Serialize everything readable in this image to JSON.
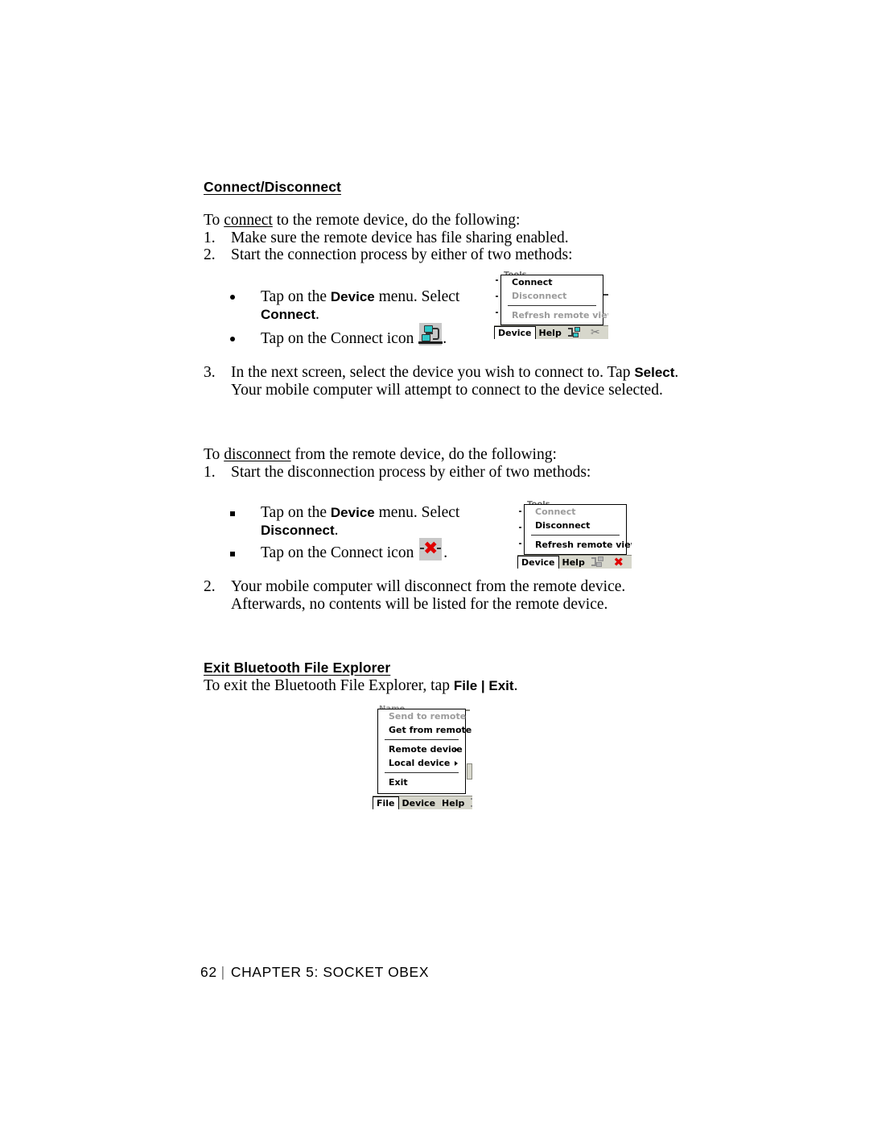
{
  "page": {
    "footer_number": "62",
    "footer_divider": "|",
    "footer_text": "CHAPTER 5: SOCKET OBEX"
  },
  "sections": {
    "connect_disconnect": {
      "heading": "Connect/Disconnect",
      "intro_pre": "To ",
      "intro_link": "connect",
      "intro_post": " to the remote device, do the following:",
      "steps": [
        {
          "marker": "1.",
          "text": "Make sure the remote device has file sharing enabled."
        },
        {
          "marker": "2.",
          "text": "Start the connection process by either of two methods:"
        }
      ],
      "bullets": [
        {
          "style": "dot",
          "pre": "Tap on the ",
          "bold1": "Device",
          "mid": " menu. Select ",
          "bold2": "Connect",
          "post": "."
        },
        {
          "style": "dot",
          "pre": "Tap on the Connect icon ",
          "icon": "connect-icon",
          "post": "."
        }
      ],
      "step3": {
        "marker": "3.",
        "line1_pre": "In the next screen, select the device you wish to connect to. Tap ",
        "line1_bold": "Select",
        "line1_post": ".",
        "line2": "Your mobile computer will attempt to connect to the device selected."
      }
    },
    "disconnect": {
      "intro_pre": "To ",
      "intro_link": "disconnect",
      "intro_post": " from the remote device, do the following:",
      "steps": [
        {
          "marker": "1.",
          "text": "Start the disconnection process by either of two methods:"
        }
      ],
      "bullets": [
        {
          "style": "square",
          "pre": "Tap on the ",
          "bold1": "Device",
          "mid": " menu. Select ",
          "bold2": "Disconnect",
          "post": "."
        },
        {
          "style": "square",
          "pre": "Tap on the Connect icon ",
          "icon": "disconnect-icon",
          "post": "."
        }
      ],
      "step2": {
        "marker": "2.",
        "line1": "Your mobile computer will disconnect from the remote device.",
        "line2": "Afterwards, no contents will be listed for the remote device."
      }
    },
    "exit": {
      "heading": "Exit Bluetooth File Explorer",
      "intro_pre": "To exit the Bluetooth File Explorer, tap ",
      "intro_bold": "File | Exit",
      "intro_post": "."
    }
  },
  "screenshots": {
    "device_menu_connect": {
      "ghost_label": "Tools",
      "items": [
        {
          "label": "Connect",
          "state": "enabled"
        },
        {
          "label": "Disconnect",
          "state": "disabled"
        },
        {
          "separator": true
        },
        {
          "label": "Refresh remote view",
          "state": "disabled"
        }
      ],
      "commandbar": {
        "buttons": [
          {
            "label": "Device",
            "active": true
          },
          {
            "label": "Help",
            "active": false
          }
        ],
        "icons": [
          "connect-icon",
          "scissors-icon",
          "wrench-icon"
        ]
      }
    },
    "device_menu_disconnect": {
      "ghost_label": "Tools",
      "items": [
        {
          "label": "Connect",
          "state": "disabled"
        },
        {
          "label": "Disconnect",
          "state": "enabled"
        },
        {
          "separator": true
        },
        {
          "label": "Refresh remote view",
          "state": "enabled"
        }
      ],
      "commandbar": {
        "buttons": [
          {
            "label": "Device",
            "active": true
          },
          {
            "label": "Help",
            "active": false
          }
        ],
        "icons": [
          "connect-icon-disabled",
          "x-icon",
          "wrench-icon"
        ]
      }
    },
    "file_menu": {
      "ghost_label": "Name",
      "items": [
        {
          "label": "Send to remote",
          "state": "disabled"
        },
        {
          "label": "Get from remote",
          "state": "enabled"
        },
        {
          "separator": true
        },
        {
          "label": "Remote device",
          "state": "enabled",
          "submenu": true
        },
        {
          "label": "Local device",
          "state": "enabled",
          "submenu": true
        },
        {
          "separator": true
        },
        {
          "label": "Exit",
          "state": "enabled"
        }
      ],
      "commandbar": {
        "buttons": [
          {
            "label": "File",
            "active": true
          },
          {
            "label": "Device",
            "active": false
          },
          {
            "label": "Help",
            "active": false
          }
        ],
        "icons": [
          "connect-icon-disabled",
          "x-icon-partial"
        ]
      }
    }
  }
}
